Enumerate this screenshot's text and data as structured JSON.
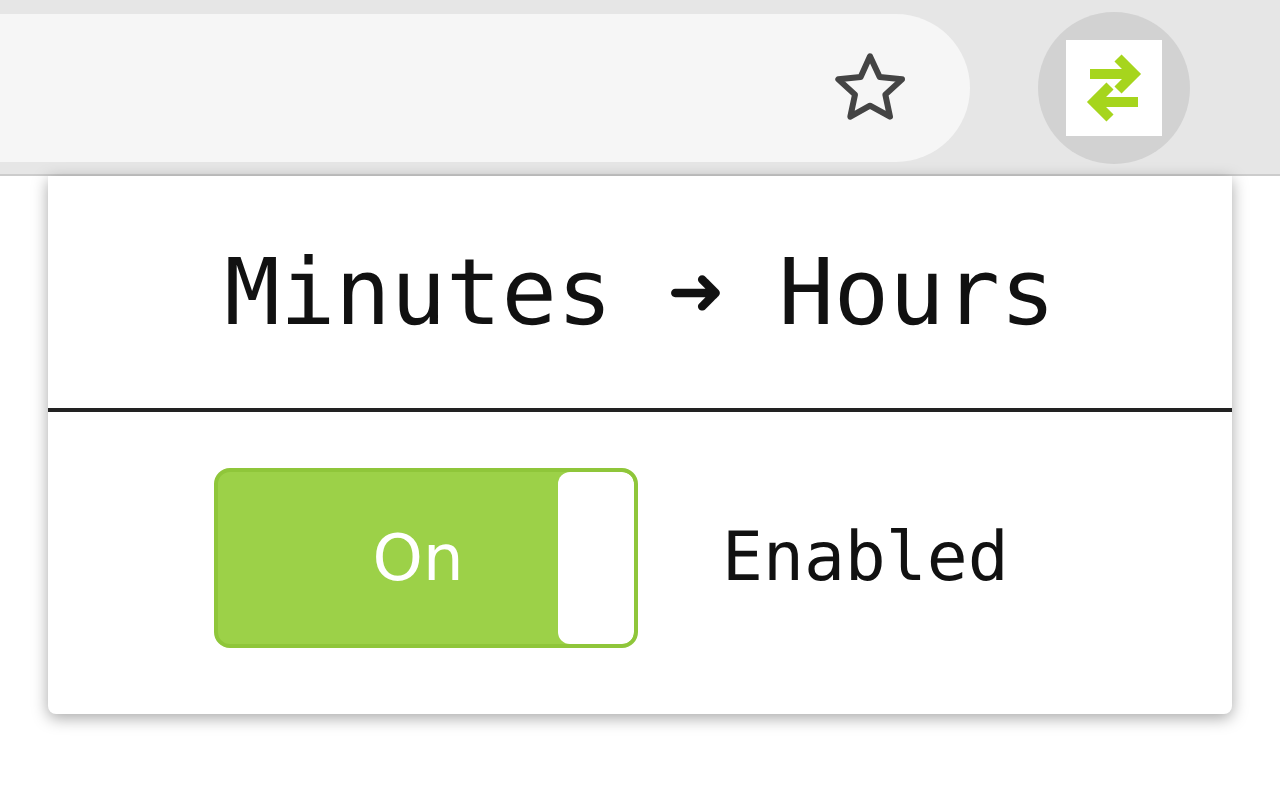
{
  "popup": {
    "title": "Minutes ➜ Hours",
    "toggle": {
      "on": true,
      "label": "On"
    },
    "status": "Enabled"
  }
}
